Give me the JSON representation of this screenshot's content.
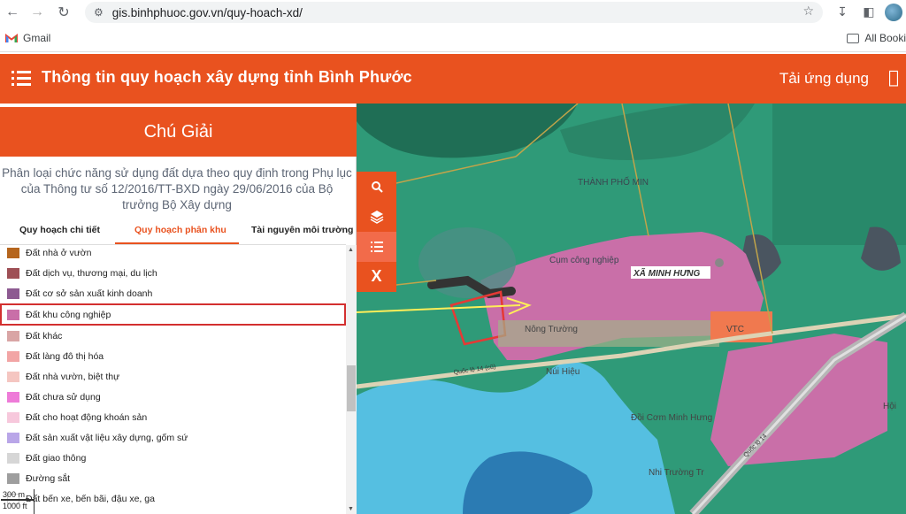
{
  "browser": {
    "url": "gis.binhphuoc.gov.vn/quy-hoach-xd/",
    "bookmark_gmail": "Gmail",
    "bookmark_all": "All Booki"
  },
  "header": {
    "title": "Thông tin quy hoạch xây dựng tỉnh Bình Phước",
    "download": "Tải ứng dụng",
    "accent_color": "#e9521f"
  },
  "legend_panel": {
    "title": "Chú Giải",
    "description": "Phân loại chức năng sử dụng đất dựa theo quy định trong Phụ lục của Thông tư số 12/2016/TT-BXD ngày 29/06/2016 của Bộ trưởng Bộ Xây dựng",
    "tabs": [
      {
        "label": "Quy hoạch chi tiết",
        "active": false
      },
      {
        "label": "Quy hoạch phân khu",
        "active": true
      },
      {
        "label": "Tài nguyên môi trường",
        "active": false
      }
    ],
    "items": [
      {
        "label": "Đất nhà ở vườn",
        "color": "#b5651d"
      },
      {
        "label": "Đất dịch vụ, thương mại, du lịch",
        "color": "#9e4f55"
      },
      {
        "label": "Đất cơ sở sản xuất kinh doanh",
        "color": "#8d5a91"
      },
      {
        "label": "Đất khu công nghiệp",
        "color": "#c96fa8",
        "highlighted": true
      },
      {
        "label": "Đất khác",
        "color": "#d9a5a5"
      },
      {
        "label": "Đất làng đô thị hóa",
        "color": "#f2a5a5"
      },
      {
        "label": "Đất nhà vườn, biệt thự",
        "color": "#f5c6c1"
      },
      {
        "label": "Đất chưa sử dụng",
        "color": "#ee7bd8"
      },
      {
        "label": "Đất cho hoạt động khoán sản",
        "color": "#f7c8dc"
      },
      {
        "label": "Đất sản xuất vật liệu xây dựng, gốm sứ",
        "color": "#b9a6e8"
      },
      {
        "label": "Đất giao thông",
        "color": "#d6d6d6"
      },
      {
        "label": "Đường sắt",
        "color": "#9e9e9e"
      },
      {
        "label": "Đất bến xe, bến bãi, đậu xe, ga",
        "color": "#ffffff"
      }
    ]
  },
  "map": {
    "labels": {
      "commune": "XÃ MINH HƯNG",
      "city": "THÀNH PHỐ MIN",
      "industrial": "Cụm công nghiệp",
      "vtc": "VTC",
      "nong_truong": "Nông Trường",
      "nui_hieu": "Núi Hiệu",
      "road_label": "Quốc lộ 14 (cũ)",
      "road_label_2": "Quốc lộ 14",
      "doi": "Đồi Cơm Minh Hưng",
      "hoi": "Hội",
      "nong_truong_2": "Nhi Trường Tr"
    },
    "tools": [
      {
        "name": "search",
        "glyph": "🔍"
      },
      {
        "name": "layers",
        "glyph": "◈"
      },
      {
        "name": "legend",
        "glyph": "☰"
      },
      {
        "name": "close",
        "glyph": "X"
      }
    ],
    "scale": {
      "metric": "300 m",
      "imperial": "1000 ft"
    }
  }
}
